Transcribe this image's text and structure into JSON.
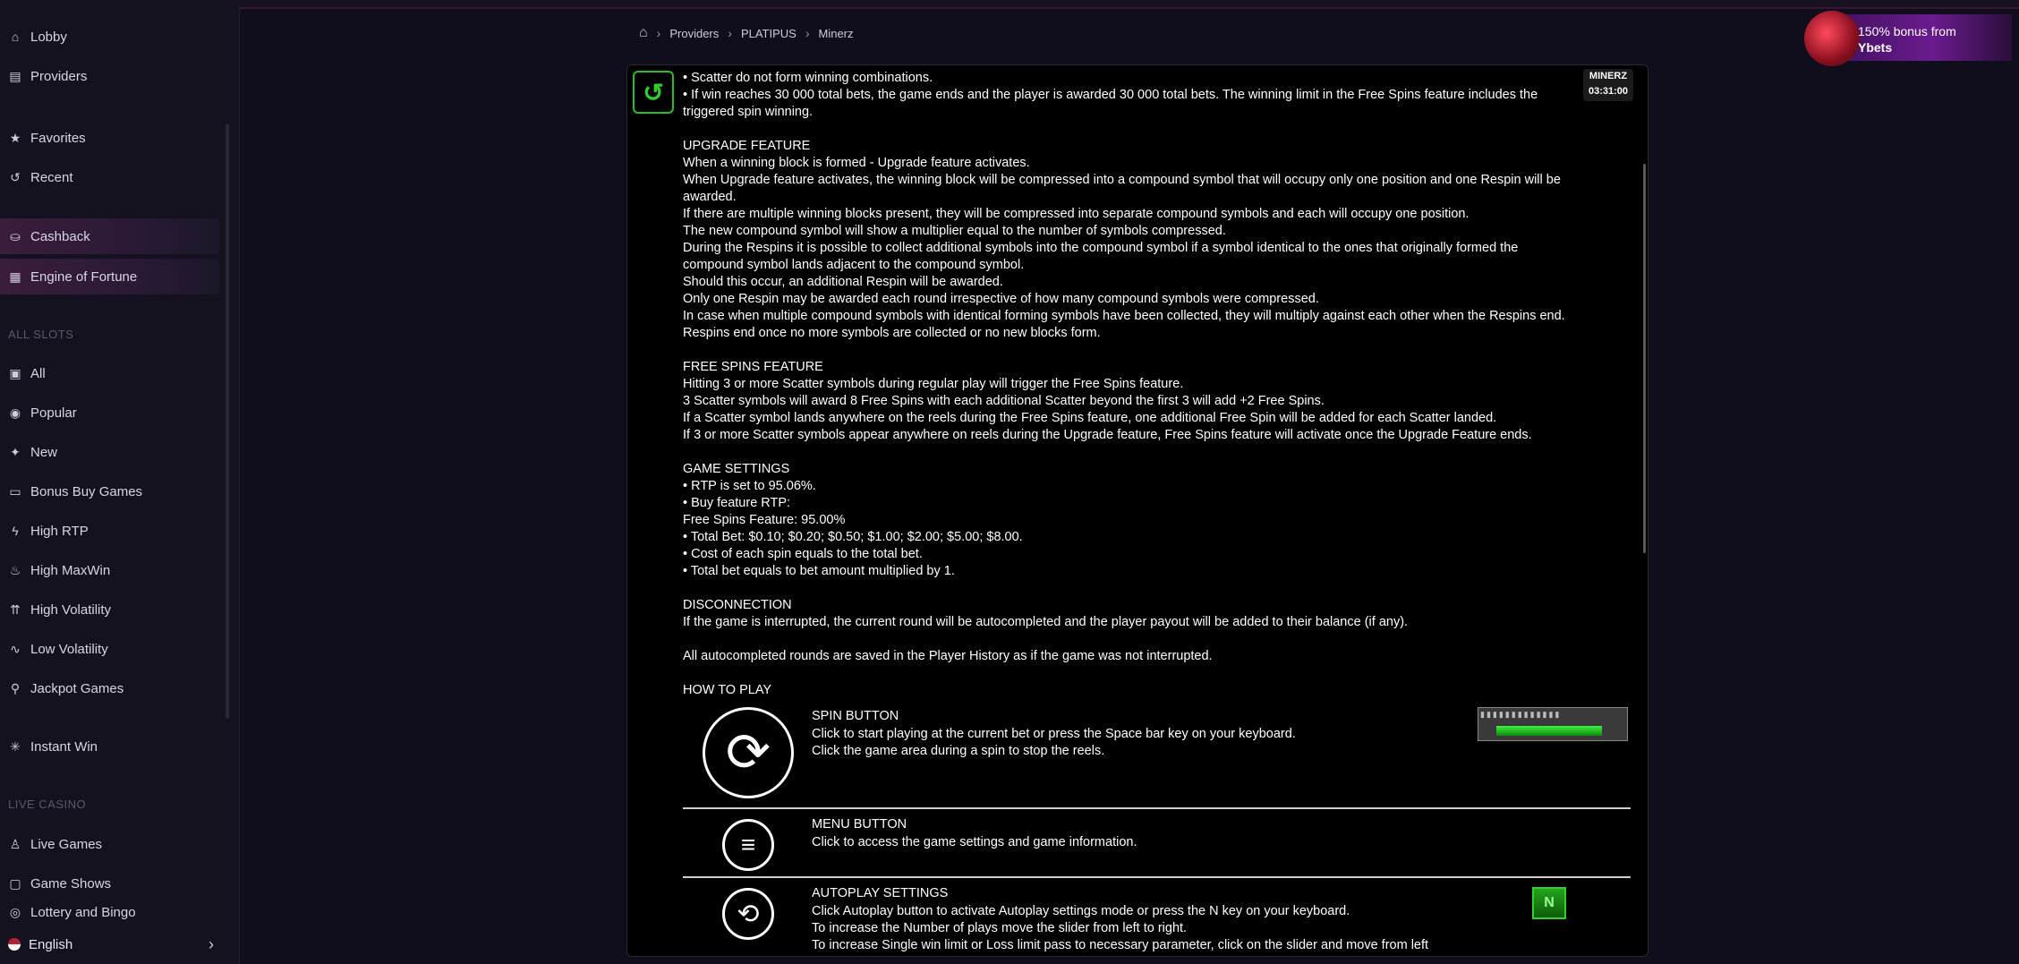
{
  "sidebar": {
    "items_top": [
      {
        "label": "Lobby",
        "icon": "home-icon"
      },
      {
        "label": "Providers",
        "icon": "providers-icon"
      },
      {
        "label": "Favorites",
        "icon": "star-icon"
      },
      {
        "label": "Recent",
        "icon": "history-icon"
      },
      {
        "label": "Cashback",
        "icon": "cashback-icon"
      },
      {
        "label": "Engine of Fortune",
        "icon": "grid-icon"
      }
    ],
    "section_slots": "ALL SLOTS",
    "slots": [
      {
        "label": "All",
        "icon": "slots-icon"
      },
      {
        "label": "Popular",
        "icon": "popular-icon"
      },
      {
        "label": "New",
        "icon": "sparkle-icon"
      },
      {
        "label": "Bonus Buy Games",
        "icon": "bonus-buy-icon"
      },
      {
        "label": "High RTP",
        "icon": "bolt-icon"
      },
      {
        "label": "High MaxWin",
        "icon": "maxwin-icon"
      },
      {
        "label": "High Volatility",
        "icon": "volatility-icon"
      },
      {
        "label": "Low Volatility",
        "icon": "low-volatility-icon"
      },
      {
        "label": "Jackpot Games",
        "icon": "jackpot-icon"
      },
      {
        "label": "Instant Win",
        "icon": "instant-icon"
      }
    ],
    "section_live": "LIVE CASINO",
    "live": [
      {
        "label": "Live Games",
        "icon": "live-icon"
      },
      {
        "label": "Game Shows",
        "icon": "show-icon"
      },
      {
        "label": "Lottery and Bingo",
        "icon": "lottery-icon"
      }
    ],
    "language": "English"
  },
  "breadcrumb": {
    "items": [
      "Providers",
      "PLATIPUS",
      "Minerz"
    ]
  },
  "bonus": {
    "line1": "150% bonus from",
    "line2": "Ybets"
  },
  "game": {
    "badge_title": "MINERZ",
    "badge_time": "03:31:00",
    "lines": [
      "• Scatter do not form winning combinations.",
      "• If win reaches 30 000 total bets, the game ends and the player is awarded 30 000 total bets. The winning limit in the Free Spins feature includes the",
      "triggered spin winning.",
      "",
      "UPGRADE FEATURE",
      "When a winning block is formed - Upgrade feature activates.",
      "When Upgrade feature activates, the winning block will be compressed into a compound symbol that will occupy only one position and one Respin will be",
      "awarded.",
      "If there are multiple winning blocks present, they will be compressed into separate compound symbols and each will occupy one position.",
      "The new compound symbol will show a multiplier equal to the number of symbols compressed.",
      "During the Respins it is possible to collect additional symbols into the compound symbol if a symbol identical to the ones that originally formed the",
      "compound symbol lands adjacent to the compound symbol.",
      "Should this occur, an additional Respin will be awarded.",
      "Only one Respin may be awarded each round irrespective of how many compound symbols were compressed.",
      "In case when multiple compound symbols with identical forming symbols have been collected, they will multiply against each other when the Respins end.",
      "Respins end once no more symbols are collected or no new blocks form.",
      "",
      "FREE SPINS FEATURE",
      "Hitting 3 or more Scatter symbols during regular play will trigger the Free Spins feature.",
      "3 Scatter symbols will award 8 Free Spins with each additional Scatter beyond the first 3 will add +2 Free Spins.",
      "If a Scatter symbol lands anywhere on the reels during the Free Spins feature, one additional Free Spin will be added for each Scatter landed.",
      "If 3 or more Scatter symbols appear anywhere on reels during the Upgrade feature, Free Spins feature will activate once the Upgrade Feature ends.",
      "",
      "GAME SETTINGS",
      "• RTP is set to 95.06%.",
      "• Buy feature RTP:",
      "Free Spins Feature: 95.00%",
      "• Total Bet:  $0.10; $0.20; $0.50; $1.00; $2.00; $5.00; $8.00.",
      "• Cost of each spin equals to the total bet.",
      "• Total bet equals to bet amount multiplied by 1.",
      "",
      "DISCONNECTION",
      "If the game is interrupted, the current round will be autocompleted and the player payout will be added to their balance (if any).",
      "",
      "All autocompleted rounds are saved in the Player History as if the game was not interrupted.",
      "",
      "HOW TO PLAY"
    ],
    "spin": {
      "title": "SPIN BUTTON",
      "l1": "Click to start playing at the current bet or press the Space bar key on your keyboard.",
      "l2": "Click the game area during a spin to stop the reels."
    },
    "menu": {
      "title": "MENU BUTTON",
      "l1": "Click to access the game settings and game information."
    },
    "autoplay": {
      "title": "AUTOPLAY SETTINGS",
      "l1": "Click Autoplay button to activate Autoplay settings mode or press the N key on your keyboard.",
      "l2": "To increase the Number of plays move the slider from left to right.",
      "l3": "To increase Single win limit or Loss limit pass to necessary parameter, click on the slider and move from left"
    },
    "n_key": "N"
  }
}
